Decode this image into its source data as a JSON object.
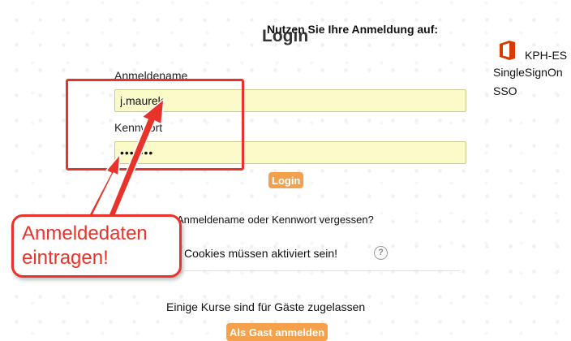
{
  "login": {
    "title": "Login",
    "username_label": "Anmeldename",
    "username_value": "j.maurek",
    "password_label": "Kennwort",
    "password_value": "•••••••",
    "login_button": "Login",
    "forgot_link": "Anmeldename oder Kennwort vergessen?",
    "cookies_text": "Cookies müssen aktiviert sein!",
    "help_icon": "question-circle-icon",
    "guest_text": "Einige Kurse sind für Gäste zugelassen",
    "guest_button": "Als Gast anmelden"
  },
  "sso": {
    "heading": "Nutzen Sie Ihre Anmeldung auf:",
    "provider_icon": "office-icon",
    "provider_name": "KPH-ES",
    "provider_line2": "SingleSignOn",
    "provider_line3": "SSO"
  },
  "annotation": {
    "callout_line1": "Anmeldedaten",
    "callout_line2": "eintragen!"
  },
  "colors": {
    "accent_orange": "#f5a04a",
    "annotation_red": "#e8332a",
    "field_yellow": "#fbfbc9",
    "office_red": "#d83b01"
  }
}
